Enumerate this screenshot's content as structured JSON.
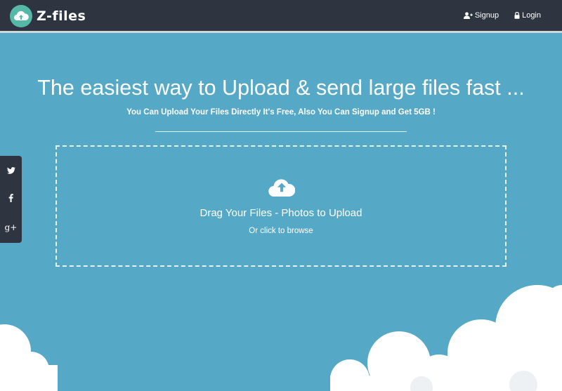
{
  "brand": {
    "name": "Z-files"
  },
  "nav": {
    "signup": "Signup",
    "login": "Login"
  },
  "hero": {
    "title": "The easiest way to Upload & send large files fast ...",
    "subtitle": "You Can Upload Your Files Directly It's Free, Also You Can Signup and Get 5GB !"
  },
  "dropzone": {
    "title": "Drag Your Files - Photos to Upload",
    "browse": "Or click to browse"
  },
  "social": [
    "twitter-icon",
    "facebook-icon",
    "google-plus-icon"
  ],
  "colors": {
    "background": "#55a9c6",
    "navbar": "#2e3541",
    "logo_accent": "#56b8a6",
    "text": "#ffffff"
  }
}
